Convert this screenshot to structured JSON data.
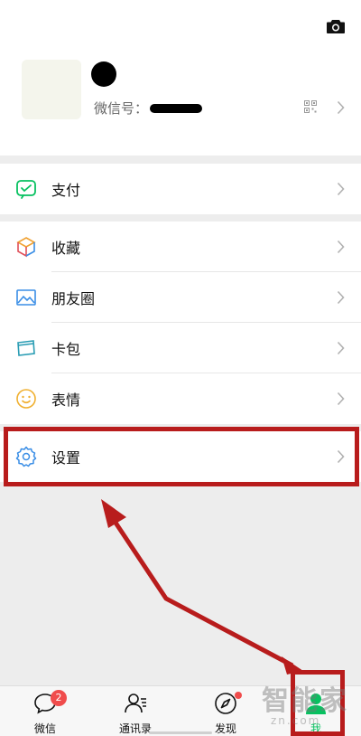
{
  "profile": {
    "wxid_label": "微信号："
  },
  "payment": {
    "label": "支付"
  },
  "services": [
    {
      "label": "收藏",
      "icon": "cube-icon"
    },
    {
      "label": "朋友圈",
      "icon": "picture-icon"
    },
    {
      "label": "卡包",
      "icon": "card-icon"
    },
    {
      "label": "表情",
      "icon": "smile-icon"
    }
  ],
  "settings": {
    "label": "设置"
  },
  "tabbar": {
    "tabs": [
      {
        "label": "微信",
        "badge": "2"
      },
      {
        "label": "通讯录"
      },
      {
        "label": "发现"
      },
      {
        "label": "我"
      }
    ]
  },
  "watermark": {
    "brand": "智能家",
    "url": "zn.com"
  },
  "colors": {
    "accent": "#07c160",
    "highlight": "#b81c1c",
    "badge": "#f04c4c"
  }
}
